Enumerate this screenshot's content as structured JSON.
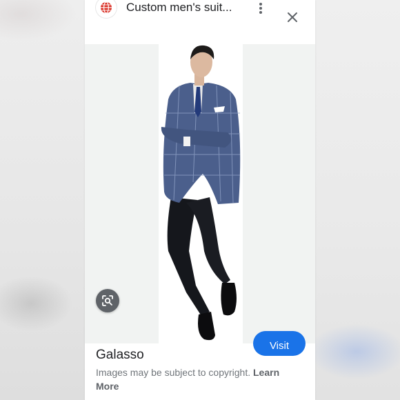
{
  "header": {
    "title": "Custom men's suit...",
    "site_icon": "globe-icon",
    "more_icon": "more-vert-icon",
    "close_icon": "close-icon"
  },
  "image": {
    "alt": "Man in blue plaid suit jacket and black trousers",
    "lens_icon": "lens-search-icon"
  },
  "actions": {
    "visit_label": "Visit"
  },
  "source": {
    "name": "Galasso"
  },
  "copyright": {
    "text": "Images may be subject to copyright.",
    "link_label": "Learn More"
  },
  "colors": {
    "accent": "#1a73e8",
    "site_icon_red": "#d93025",
    "text_primary": "#202124",
    "text_secondary": "#70757a"
  }
}
